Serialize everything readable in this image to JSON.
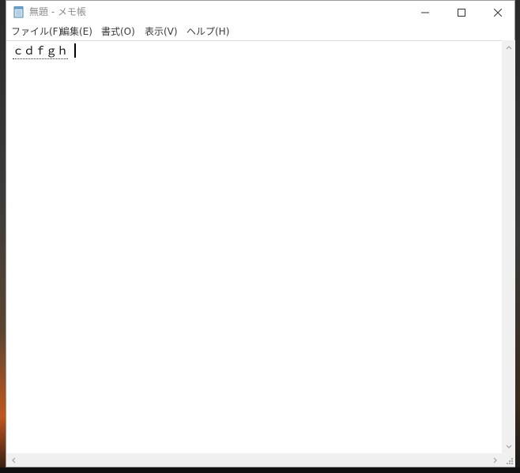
{
  "window": {
    "title": "無題 - メモ帳",
    "app_icon": "notepad-icon"
  },
  "caption_buttons": {
    "minimize": "minimize-icon",
    "maximize": "maximize-icon",
    "close": "close-icon"
  },
  "menu": {
    "items": [
      {
        "label": "ファイル(F)"
      },
      {
        "label": "編集(E)"
      },
      {
        "label": "書式(O)"
      },
      {
        "label": "表示(V)"
      },
      {
        "label": "ヘルプ(H)"
      }
    ]
  },
  "editor": {
    "content": "ｃｄｆｇｈ"
  },
  "colors": {
    "title_inactive": "#8a8a8a",
    "menu_text": "#3a3a3a",
    "scroll_track": "#f0f0f0"
  }
}
